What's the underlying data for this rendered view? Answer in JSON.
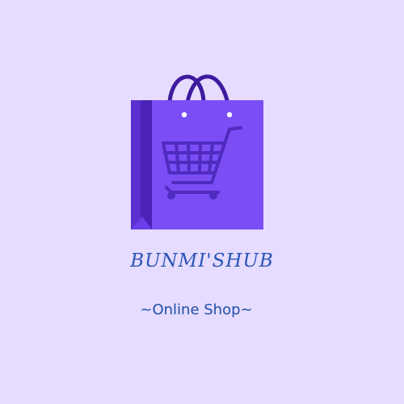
{
  "brand": {
    "name": "BUNMI'SHUB",
    "tagline": "~Online Shop~"
  },
  "icons": {
    "bag": "shopping-bag-icon",
    "cart": "shopping-cart-icon"
  },
  "colors": {
    "background": "#e6dcff",
    "bag_front": "#7a4df5",
    "bag_side": "#4a22b8",
    "bag_handle": "#3d1a9e",
    "cart": "#4f2bc0",
    "text": "#2a55b8"
  }
}
